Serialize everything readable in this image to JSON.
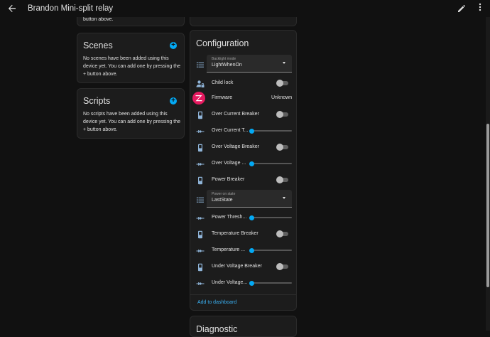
{
  "topbar": {
    "title": "Brandon Mini-split relay"
  },
  "leftcol": {
    "top_fragment": "button above.",
    "scenes": {
      "title": "Scenes",
      "desc": "No scenes have been added using this device yet. You can add one by pressing the + button above."
    },
    "scripts": {
      "title": "Scripts",
      "desc": "No scripts have been added using this device yet. You can add one by pressing the + button above."
    }
  },
  "configuration": {
    "title": "Configuration",
    "backlight": {
      "label": "Backlight mode",
      "value": "LightWhenOn"
    },
    "child_lock": {
      "label": "Child lock",
      "on": false
    },
    "firmware": {
      "label": "Firmware",
      "value": "Unknown"
    },
    "over_current_breaker": {
      "label": "Over Current Breaker",
      "on": false
    },
    "over_current_threshold": {
      "label": "Over Current T...",
      "level": 0
    },
    "over_voltage_breaker": {
      "label": "Over Voltage Breaker",
      "on": false
    },
    "over_voltage_threshold": {
      "label": "Over Voltage ...",
      "level": 0
    },
    "power_breaker": {
      "label": "Power Breaker",
      "on": false
    },
    "power_on_state": {
      "label": "Power on state",
      "value": "LastState"
    },
    "power_threshold": {
      "label": "Power Thresh...",
      "level": 0
    },
    "temperature_breaker": {
      "label": "Temperature Breaker",
      "on": false
    },
    "temperature_threshold": {
      "label": "Temperature ...",
      "level": 0
    },
    "under_voltage_breaker": {
      "label": "Under Voltage Breaker",
      "on": false
    },
    "under_voltage_threshold": {
      "label": "Under Voltage...",
      "level": 0
    },
    "add_to_dashboard": "Add to dashboard"
  },
  "diagnostic": {
    "title": "Diagnostic"
  },
  "colors": {
    "accent": "#03a9f4",
    "icon": "#8fb4d8",
    "zigbee": "#e5195f"
  }
}
